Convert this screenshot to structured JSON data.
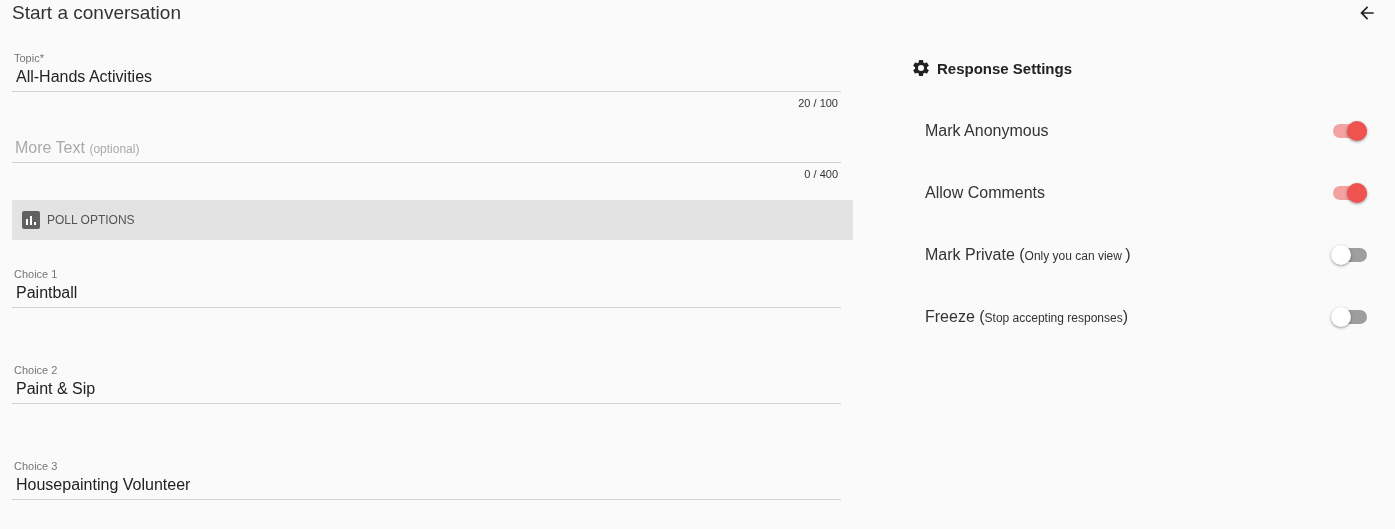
{
  "title": "Start a conversation",
  "topic": {
    "label": "Topic",
    "required_mark": "*",
    "value": "All-Hands Activities",
    "counter": "20 / 100"
  },
  "more_text": {
    "placeholder": "More Text",
    "placeholder_note": "(optional)",
    "counter": "0 / 400"
  },
  "poll": {
    "heading": "POLL OPTIONS",
    "choices": [
      {
        "label": "Choice 1",
        "value": "Paintball"
      },
      {
        "label": "Choice 2",
        "value": "Paint & Sip"
      },
      {
        "label": "Choice 3",
        "value": "Housepainting Volunteer"
      }
    ]
  },
  "settings": {
    "heading": "Response Settings",
    "items": [
      {
        "label": "Mark Anonymous",
        "on": true
      },
      {
        "label": "Allow Comments",
        "on": true
      },
      {
        "label": "Mark Private (",
        "note": "Only you can view ",
        "close": ")",
        "on": false
      },
      {
        "label": "Freeze (",
        "note": "Stop accepting responses",
        "close": ")",
        "on": false
      }
    ]
  }
}
